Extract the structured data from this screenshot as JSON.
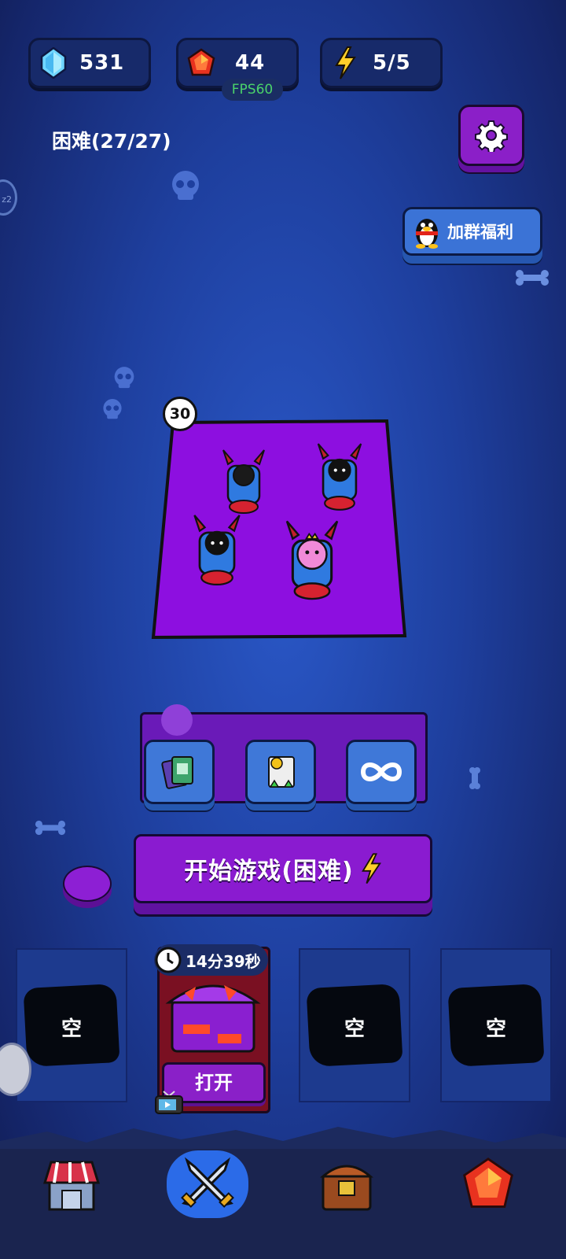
{
  "hud": {
    "diamonds": "531",
    "rubies": "44",
    "energy": "5/5",
    "fps": "FPS60"
  },
  "difficulty_label": "困难(27/27)",
  "qq_button_label": "加群福利",
  "side_badge": "z2",
  "board": {
    "badge": "30",
    "enemies": [
      "black-horned-cart",
      "black-horned-cart",
      "black-horned-cart",
      "pink-crowned-cart"
    ]
  },
  "skills": [
    "card-deck-icon",
    "coin-upgrade-icon",
    "infinity-icon"
  ],
  "start_button_label": "开始游戏(困难)",
  "chest_slots": {
    "empty_label": "空",
    "timer": "14分39秒",
    "open_label": "打开"
  },
  "nav": [
    "shop-icon",
    "battle-swords-icon",
    "chest-icon",
    "ruby-icon"
  ],
  "colors": {
    "background": "#1e3f9e",
    "purple": "#8a1bd0",
    "blue_button": "#3f78d8",
    "fps_green": "#4ad36a"
  }
}
